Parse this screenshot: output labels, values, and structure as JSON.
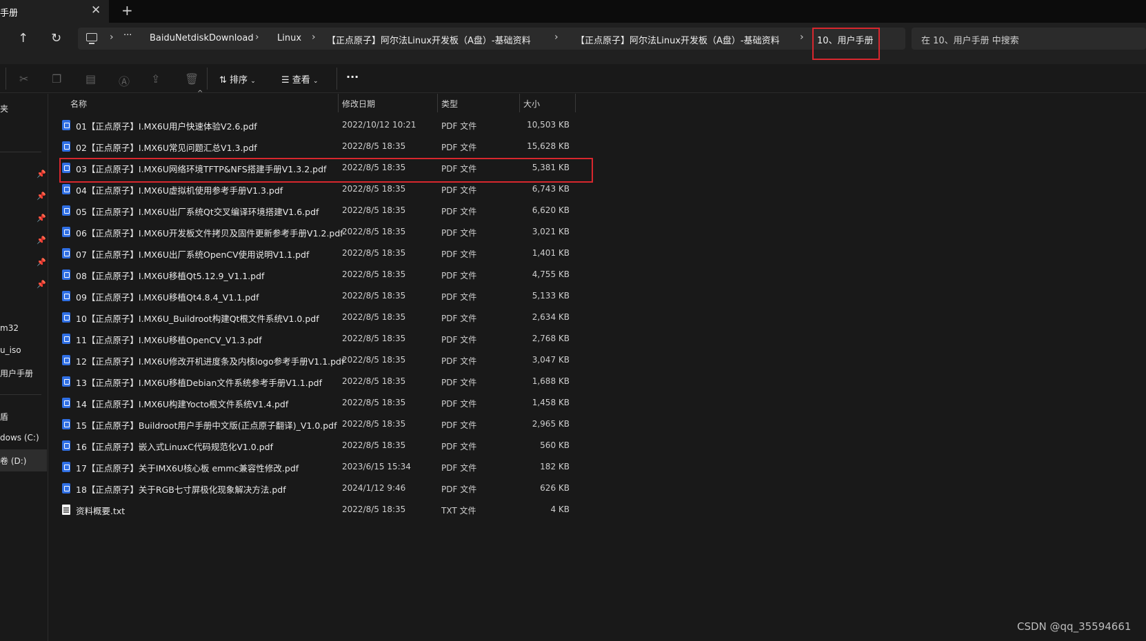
{
  "tab": {
    "title": "手册",
    "close": "✕",
    "new": "+"
  },
  "nav": {
    "up": "↑",
    "refresh": "↻"
  },
  "breadcrumb": {
    "items": [
      "BaiduNetdiskDownload",
      "Linux",
      "【正点原子】阿尔法Linux开发板（A盘）-基础资料",
      "【正点原子】阿尔法Linux开发板（A盘）-基础资料",
      "10、用户手册"
    ],
    "more": "···"
  },
  "search": {
    "placeholder": "在 10、用户手册 中搜索"
  },
  "toolbar": {
    "sort_label": "排序",
    "view_label": "查看",
    "more": "···"
  },
  "sidebar": {
    "items": [
      {
        "label": "夹"
      },
      {
        "label": "m32"
      },
      {
        "label": "u_iso"
      },
      {
        "label": "用户手册"
      },
      {
        "label": "盾"
      },
      {
        "label": "dows (C:)"
      },
      {
        "label": "卷 (D:)"
      }
    ]
  },
  "columns": {
    "name": "名称",
    "date": "修改日期",
    "type": "类型",
    "size": "大小"
  },
  "files": [
    {
      "name": "01【正点原子】I.MX6U用户快速体验V2.6.pdf",
      "date": "2022/10/12 10:21",
      "type": "PDF 文件",
      "size": "10,503 KB",
      "kind": "pdf"
    },
    {
      "name": "02【正点原子】I.MX6U常见问题汇总V1.3.pdf",
      "date": "2022/8/5 18:35",
      "type": "PDF 文件",
      "size": "15,628 KB",
      "kind": "pdf"
    },
    {
      "name": "03【正点原子】I.MX6U网络环境TFTP&NFS搭建手册V1.3.2.pdf",
      "date": "2022/8/5 18:35",
      "type": "PDF 文件",
      "size": "5,381 KB",
      "kind": "pdf"
    },
    {
      "name": "04【正点原子】I.MX6U虚拟机使用参考手册V1.3.pdf",
      "date": "2022/8/5 18:35",
      "type": "PDF 文件",
      "size": "6,743 KB",
      "kind": "pdf"
    },
    {
      "name": "05【正点原子】I.MX6U出厂系统Qt交叉编译环境搭建V1.6.pdf",
      "date": "2022/8/5 18:35",
      "type": "PDF 文件",
      "size": "6,620 KB",
      "kind": "pdf"
    },
    {
      "name": "06【正点原子】I.MX6U开发板文件拷贝及固件更新参考手册V1.2.pdf",
      "date": "2022/8/5 18:35",
      "type": "PDF 文件",
      "size": "3,021 KB",
      "kind": "pdf"
    },
    {
      "name": "07【正点原子】I.MX6U出厂系统OpenCV使用说明V1.1.pdf",
      "date": "2022/8/5 18:35",
      "type": "PDF 文件",
      "size": "1,401 KB",
      "kind": "pdf"
    },
    {
      "name": "08【正点原子】I.MX6U移植Qt5.12.9_V1.1.pdf",
      "date": "2022/8/5 18:35",
      "type": "PDF 文件",
      "size": "4,755 KB",
      "kind": "pdf"
    },
    {
      "name": "09【正点原子】I.MX6U移植Qt4.8.4_V1.1.pdf",
      "date": "2022/8/5 18:35",
      "type": "PDF 文件",
      "size": "5,133 KB",
      "kind": "pdf"
    },
    {
      "name": "10【正点原子】I.MX6U_Buildroot构建Qt根文件系统V1.0.pdf",
      "date": "2022/8/5 18:35",
      "type": "PDF 文件",
      "size": "2,634 KB",
      "kind": "pdf"
    },
    {
      "name": "11【正点原子】I.MX6U移植OpenCV_V1.3.pdf",
      "date": "2022/8/5 18:35",
      "type": "PDF 文件",
      "size": "2,768 KB",
      "kind": "pdf"
    },
    {
      "name": "12【正点原子】I.MX6U修改开机进度条及内核logo参考手册V1.1.pdf",
      "date": "2022/8/5 18:35",
      "type": "PDF 文件",
      "size": "3,047 KB",
      "kind": "pdf"
    },
    {
      "name": "13【正点原子】I.MX6U移植Debian文件系统参考手册V1.1.pdf",
      "date": "2022/8/5 18:35",
      "type": "PDF 文件",
      "size": "1,688 KB",
      "kind": "pdf"
    },
    {
      "name": "14【正点原子】I.MX6U构建Yocto根文件系统V1.4.pdf",
      "date": "2022/8/5 18:35",
      "type": "PDF 文件",
      "size": "1,458 KB",
      "kind": "pdf"
    },
    {
      "name": "15【正点原子】Buildroot用户手册中文版(正点原子翻译)_V1.0.pdf",
      "date": "2022/8/5 18:35",
      "type": "PDF 文件",
      "size": "2,965 KB",
      "kind": "pdf"
    },
    {
      "name": "16【正点原子】嵌入式LinuxC代码规范化V1.0.pdf",
      "date": "2022/8/5 18:35",
      "type": "PDF 文件",
      "size": "560 KB",
      "kind": "pdf"
    },
    {
      "name": "17【正点原子】关于IMX6U核心板 emmc兼容性修改.pdf",
      "date": "2023/6/15 15:34",
      "type": "PDF 文件",
      "size": "182 KB",
      "kind": "pdf"
    },
    {
      "name": "18【正点原子】关于RGB七寸屏极化现象解决方法.pdf",
      "date": "2024/1/12 9:46",
      "type": "PDF 文件",
      "size": "626 KB",
      "kind": "pdf"
    },
    {
      "name": "资料概要.txt",
      "date": "2022/8/5 18:35",
      "type": "TXT 文件",
      "size": "4 KB",
      "kind": "txt"
    }
  ],
  "watermark": "CSDN @qq_35594661",
  "colors": {
    "highlight": "#d9272e",
    "pdf_icon": "#2f6fe4",
    "background": "#191919"
  }
}
